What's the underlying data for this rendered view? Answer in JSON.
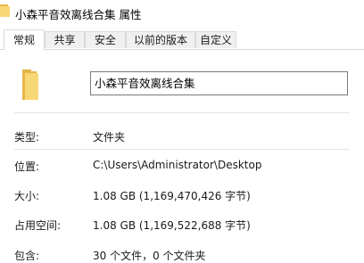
{
  "window": {
    "title": "小森平音效离线合集 属性"
  },
  "tabs": [
    {
      "label": "常规",
      "active": true
    },
    {
      "label": "共享",
      "active": false
    },
    {
      "label": "安全",
      "active": false
    },
    {
      "label": "以前的版本",
      "active": false
    },
    {
      "label": "自定义",
      "active": false
    }
  ],
  "folder": {
    "name": "小森平音效离线合集",
    "icon": "folder-icon"
  },
  "properties": {
    "type": {
      "label": "类型:",
      "value": "文件夹"
    },
    "location": {
      "label": "位置:",
      "value": "C:\\Users\\Administrator\\Desktop"
    },
    "size": {
      "label": "大小:",
      "value": "1.08 GB (1,169,470,426 字节)"
    },
    "size_on_disk": {
      "label": "占用空间:",
      "value": "1.08 GB (1,169,522,688 字节)"
    },
    "contains": {
      "label": "包含:",
      "value": "30 个文件，0 个文件夹"
    }
  },
  "colors": {
    "folder_yellow": "#f8d775",
    "folder_dark": "#e0b240"
  }
}
